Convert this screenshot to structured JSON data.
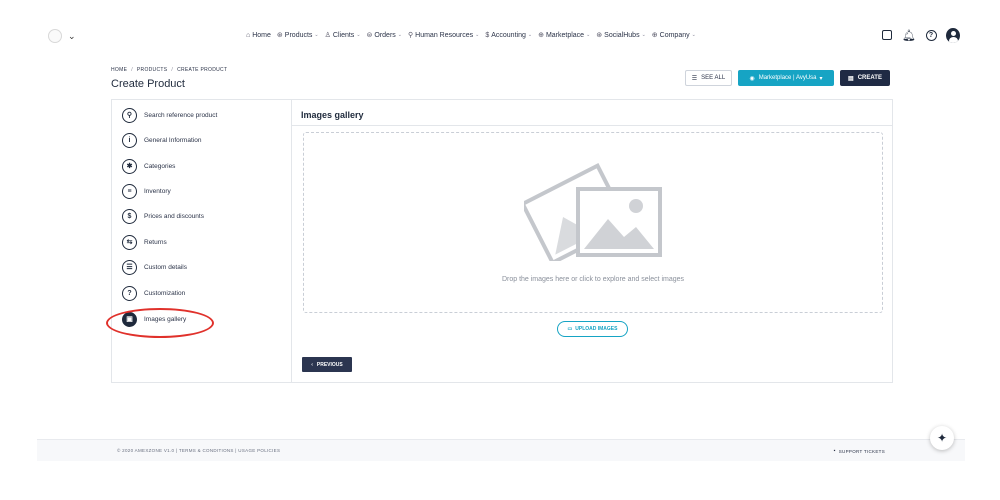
{
  "nav": {
    "items": [
      {
        "icon": "home-icon",
        "glyph": "⌂",
        "label": "Home",
        "caret": ""
      },
      {
        "icon": "products-icon",
        "glyph": "⊛",
        "label": "Products",
        "caret": "⌄"
      },
      {
        "icon": "clients-icon",
        "glyph": "♙",
        "label": "Clients",
        "caret": "⌄"
      },
      {
        "icon": "orders-icon",
        "glyph": "⊜",
        "label": "Orders",
        "caret": "⌄"
      },
      {
        "icon": "hr-icon",
        "glyph": "⚲",
        "label": "Human Resources",
        "caret": "⌄"
      },
      {
        "icon": "accounting-icon",
        "glyph": "$",
        "label": "Accounting",
        "caret": "⌄"
      },
      {
        "icon": "marketplace-icon",
        "glyph": "⊕",
        "label": "Marketplace",
        "caret": "⌄"
      },
      {
        "icon": "socialhubs-icon",
        "glyph": "⊛",
        "label": "SocialHubs",
        "caret": "⌄"
      },
      {
        "icon": "company-icon",
        "glyph": "⊕",
        "label": "Company",
        "caret": "⌄"
      }
    ]
  },
  "header": {
    "breadcrumb": [
      "HOME",
      "PRODUCTS",
      "CREATE PRODUCT"
    ],
    "title": "Create Product",
    "see_all": "SEE ALL",
    "marketplace": "Marketplace | AvyUsa",
    "marketplace_caret": "▾",
    "create": "CREATE"
  },
  "sidebar": {
    "items": [
      {
        "icon": "search-icon",
        "glyph": "⚲",
        "label": "Search reference product"
      },
      {
        "icon": "info-icon",
        "glyph": "i",
        "label": "General Information"
      },
      {
        "icon": "categories-icon",
        "glyph": "✱",
        "label": "Categories"
      },
      {
        "icon": "inventory-icon",
        "glyph": "≡",
        "label": "Inventory"
      },
      {
        "icon": "dollar-icon",
        "glyph": "$",
        "label": "Prices and discounts"
      },
      {
        "icon": "returns-icon",
        "glyph": "⇆",
        "label": "Returns"
      },
      {
        "icon": "list-icon",
        "glyph": "☰",
        "label": "Custom details"
      },
      {
        "icon": "question-icon",
        "glyph": "?",
        "label": "Customization"
      },
      {
        "icon": "images-icon",
        "glyph": "▣",
        "label": "Images gallery"
      }
    ]
  },
  "main": {
    "section_title": "Images gallery",
    "drop_text": "Drop the images here or click to explore and select images",
    "upload_label": "UPLOAD IMAGES",
    "previous_label": "PREVIOUS"
  },
  "footer": {
    "left": "© 2020 AMEXZONE V1.0 | TERMS & CONDITIONS | USAGE POLICIES",
    "right": "SUPPORT TICKETS"
  },
  "colors": {
    "accent": "#16a4c4",
    "dark": "#1f2a44",
    "highlight": "#e0312b"
  }
}
